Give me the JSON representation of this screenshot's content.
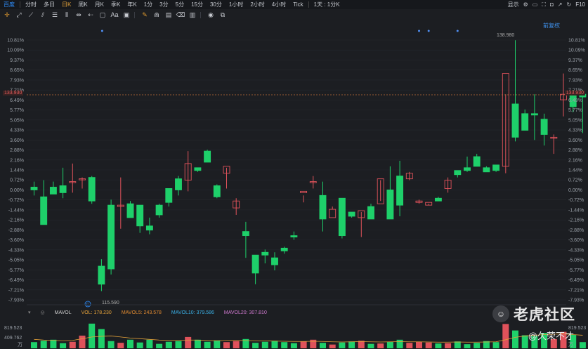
{
  "timeframe_bar": {
    "items": [
      "百度",
      "分时",
      "多日",
      "日K",
      "周K",
      "月K",
      "季K",
      "年K",
      "1分",
      "3分",
      "5分",
      "15分",
      "30分",
      "1小时",
      "2小时",
      "4小时",
      "Tick",
      "1天 : 1分K"
    ],
    "active_index": 0,
    "highlight_index": 3,
    "right_items": [
      "显示",
      "F10"
    ]
  },
  "restore_label": "前复权",
  "price_axis": {
    "labels": [
      "10.81%",
      "10.09%",
      "9.37%",
      "8.65%",
      "7.93%",
      "7.21%",
      "6.49%",
      "5.77%",
      "5.05%",
      "4.33%",
      "3.60%",
      "2.88%",
      "2.16%",
      "1.44%",
      "0.72%",
      "0.00%",
      "-0.72%",
      "-1.44%",
      "-2.16%",
      "-2.88%",
      "-3.60%",
      "-4.33%",
      "-5.05%",
      "-5.77%",
      "-6.49%",
      "-7.21%",
      "-7.93%"
    ]
  },
  "current_price_tag": "133.930",
  "high_label": "138.980",
  "low_label": "115.590",
  "marker_label": "C",
  "volume": {
    "name": "MAVOL",
    "vol": "VOL: 178.230",
    "mavol5": "MAVOL5: 243.578",
    "mavol10": "MAVOL10: 379.586",
    "mavol20": "MAVOL20: 307.810",
    "axis_top": "819.523",
    "axis_mid": "409.762",
    "axis_unit": "万"
  },
  "watermark": {
    "logo": "☺",
    "text": "老虎社区"
  },
  "author": "@久荣不才",
  "colors": {
    "up": "#e0525b",
    "down": "#1ed06a",
    "ma": "#e4a23a"
  },
  "chart_data": {
    "type": "candlestick",
    "series_mapping": "o,h,l,c in percent change",
    "candles": [
      [
        0.2,
        0.6,
        -0.4,
        0.0
      ],
      [
        -0.5,
        0.7,
        -2.2,
        -2.5
      ],
      [
        0.2,
        0.6,
        -0.3,
        -0.3
      ],
      [
        0.3,
        1.6,
        -0.6,
        -0.2
      ],
      [
        0.6,
        1.9,
        -0.2,
        0.6
      ],
      [
        0.8,
        0.9,
        0.1,
        0.8
      ],
      [
        0.9,
        1.0,
        -1.0,
        -0.8
      ],
      [
        -5.5,
        -5.0,
        -7.3,
        -6.8
      ],
      [
        -1.1,
        -0.7,
        -6.1,
        -5.7
      ],
      [
        -1.2,
        0.9,
        -2.8,
        -1.1
      ],
      [
        -1.0,
        -0.8,
        -1.3,
        -2.0
      ],
      [
        -1.1,
        -1.5,
        -3.1,
        -2.6
      ],
      [
        -2.6,
        -2.0,
        -3.2,
        -2.9
      ],
      [
        -1.1,
        -1.0,
        -2.0,
        -1.8
      ],
      [
        0.1,
        -0.1,
        -1.2,
        -0.9
      ],
      [
        0.8,
        1.0,
        -0.4,
        0.0
      ],
      [
        0.7,
        2.8,
        -0.1,
        1.9
      ],
      [
        1.6,
        1.6,
        1.3,
        1.4
      ],
      [
        2.8,
        2.9,
        2.0,
        2.0
      ],
      [
        0.3,
        0.4,
        -0.6,
        -0.5
      ],
      [
        1.2,
        1.6,
        0.1,
        1.7
      ],
      [
        -1.3,
        -0.6,
        -1.8,
        -0.8
      ],
      [
        -3.0,
        -2.3,
        -4.9,
        -3.3
      ],
      [
        -4.7,
        -5.4,
        -6.8,
        -6.0
      ],
      [
        -4.5,
        -4.3,
        -5.3,
        -4.7
      ],
      [
        -4.9,
        -4.5,
        -5.8,
        -5.4
      ],
      [
        -4.2,
        -4.1,
        -4.6,
        -4.4
      ],
      [
        -3.3,
        -3.0,
        -3.6,
        -3.4
      ],
      [
        -0.2,
        -0.4,
        -0.9,
        -0.1
      ],
      [
        0.6,
        1.0,
        0.1,
        0.6
      ],
      [
        -0.4,
        0.6,
        -3.0,
        -2.1
      ],
      [
        -2.0,
        -1.4,
        -1.2,
        -1.4
      ],
      [
        -0.6,
        -0.6,
        -3.5,
        -3.3
      ],
      [
        -1.6,
        -1.6,
        -2.0,
        -1.9
      ],
      [
        -2.0,
        -1.6,
        -3.4,
        -1.5
      ],
      [
        -1.2,
        -1.0,
        -2.1,
        -2.1
      ],
      [
        -1.0,
        0.7,
        -0.8,
        0.8
      ],
      [
        0.0,
        1.7,
        -1.8,
        -2.1
      ],
      [
        1.0,
        2.1,
        -1.9,
        -1.1
      ],
      [
        0.8,
        1.3,
        0.7,
        1.2
      ],
      [
        -0.9,
        -0.7,
        -1.0,
        -0.8
      ],
      [
        -1.1,
        -1.0,
        -1.1,
        -0.9
      ],
      [
        -0.6,
        -0.5,
        -0.8,
        -0.8
      ],
      [
        0.1,
        0.9,
        -0.2,
        0.7
      ],
      [
        1.4,
        1.4,
        0.9,
        1.1
      ],
      [
        1.6,
        2.4,
        1.3,
        1.4
      ],
      [
        2.4,
        2.6,
        1.7,
        1.7
      ],
      [
        1.6,
        1.7,
        1.5,
        1.3
      ],
      [
        1.8,
        1.8,
        1.3,
        1.4
      ],
      [
        1.7,
        6.9,
        1.2,
        8.4
      ],
      [
        6.2,
        10.8,
        3.5,
        3.8
      ],
      [
        5.5,
        5.8,
        4.4,
        4.3
      ],
      [
        5.5,
        6.9,
        3.6,
        5.4
      ],
      [
        5.1,
        5.5,
        3.2,
        4.0
      ],
      [
        3.8,
        4.0,
        2.6,
        3.8
      ],
      [
        6.5,
        8.4,
        5.3,
        6.9
      ],
      [
        6.9,
        7.2,
        5.6,
        6.0
      ],
      [
        6.9,
        7.2,
        4.1,
        6.7
      ]
    ],
    "volumes": [
      180,
      220,
      250,
      150,
      190,
      370,
      720,
      560,
      210,
      160,
      250,
      170,
      250,
      130,
      190,
      210,
      330,
      250,
      190,
      230,
      180,
      210,
      270,
      160,
      190,
      220,
      180,
      150,
      200,
      250,
      160,
      110,
      170,
      200,
      220,
      130,
      140,
      190,
      250,
      160,
      190,
      170,
      140,
      150,
      200,
      120,
      160,
      210,
      180,
      710,
      520,
      380,
      360,
      450,
      270,
      480,
      400,
      180
    ],
    "ma_line": [
      260,
      240,
      230,
      220,
      230,
      280,
      330,
      350,
      360,
      330,
      300,
      280,
      260,
      240,
      230,
      230,
      240,
      240,
      230,
      220,
      230,
      230,
      225,
      220,
      215,
      210,
      205,
      200,
      200,
      205,
      200,
      190,
      185,
      190,
      195,
      190,
      185,
      190,
      195,
      190,
      190,
      185,
      180,
      180,
      185,
      180,
      180,
      185,
      190,
      250,
      320,
      360,
      380,
      400,
      410,
      420,
      400,
      380
    ]
  }
}
